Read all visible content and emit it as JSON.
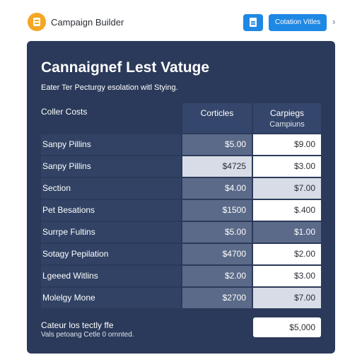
{
  "header": {
    "app_title": "Campaign Builder",
    "primary_button": "Cotation Vitles",
    "chevron": "›"
  },
  "panel": {
    "title": "Cannaignef Lest Vatuge",
    "subtitle": "Eater Ter Pecturgy esolation witl Stying."
  },
  "table": {
    "header_label": "Coller Costs",
    "col1_header": "Corticles",
    "col2_header": "Carpiegs",
    "col2_subheader": "Campiuns",
    "rows": [
      {
        "label": "Sanpy Pillins",
        "c1": "$5.00",
        "c2": "$9.00",
        "c1_style": "dark",
        "c2_style": "white"
      },
      {
        "label": "Sanpy Pillins",
        "c1": "$4725",
        "c2": "$3.00",
        "c1_style": "light",
        "c2_style": "white"
      },
      {
        "label": "Section",
        "c1": "$4.00",
        "c2": "$7.00",
        "c1_style": "dark",
        "c2_style": "light"
      },
      {
        "label": "Pet Besations",
        "c1": "$1500",
        "c2": "$.400",
        "c1_style": "dark",
        "c2_style": "white"
      },
      {
        "label": "Surrpe Fultins",
        "c1": "$5.00",
        "c2": "$1.00",
        "c1_style": "dark",
        "c2_style": "dark"
      },
      {
        "label": "Sotagy Pepilation",
        "c1": "$4700",
        "c2": "$2.00",
        "c1_style": "dark",
        "c2_style": "white"
      },
      {
        "label": "Lgeeed Witlins",
        "c1": "$2.00",
        "c2": "$3.00",
        "c1_style": "dark",
        "c2_style": "white"
      },
      {
        "label": "Molelgy Mone",
        "c1": "$2700",
        "c2": "$7.00",
        "c1_style": "dark",
        "c2_style": "light"
      }
    ]
  },
  "footer": {
    "title": "Cateur los tectly ffe",
    "subtitle": "Vals petoang Cetle 0 ornnted.",
    "total": "$5,000"
  },
  "colors": {
    "panel": "#2b3a5a",
    "accent": "#1e88e5",
    "logo": "#f5a623"
  },
  "icons": {
    "logo": "campaign-logo-icon",
    "doc_button": "document-icon",
    "chevron": "chevron-right-icon"
  }
}
